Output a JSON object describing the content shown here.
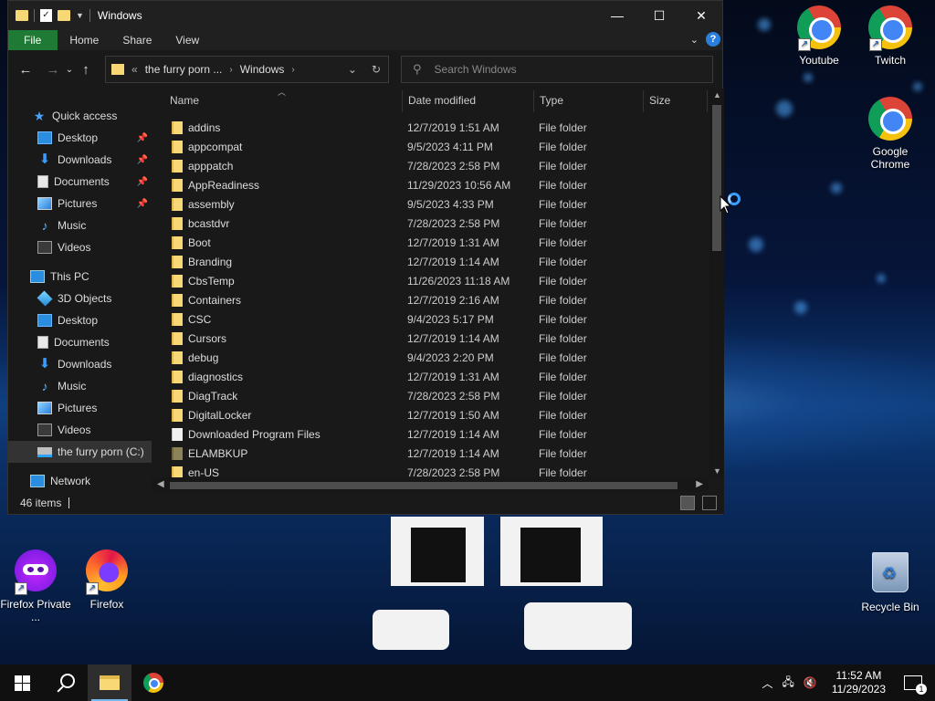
{
  "window": {
    "title": "Windows",
    "ribbon_tabs": [
      "File",
      "Home",
      "Share",
      "View"
    ],
    "address": {
      "parent": "the furry porn ...",
      "current": "Windows"
    },
    "search": {
      "placeholder": "Search Windows"
    },
    "status": {
      "item_count": "46 items"
    }
  },
  "sidebar": {
    "items": [
      {
        "label": "Quick access",
        "icon": "star-icon"
      },
      {
        "label": "Desktop",
        "icon": "desktop-icon",
        "pinned": true
      },
      {
        "label": "Downloads",
        "icon": "download-icon",
        "pinned": true
      },
      {
        "label": "Documents",
        "icon": "documents-icon",
        "pinned": true
      },
      {
        "label": "Pictures",
        "icon": "pictures-icon",
        "pinned": true
      },
      {
        "label": "Music",
        "icon": "music-icon"
      },
      {
        "label": "Videos",
        "icon": "videos-icon"
      },
      {
        "label": "This PC",
        "icon": "computer-icon"
      },
      {
        "label": "3D Objects",
        "icon": "3d-objects-icon"
      },
      {
        "label": "Desktop",
        "icon": "desktop-icon"
      },
      {
        "label": "Documents",
        "icon": "documents-icon"
      },
      {
        "label": "Downloads",
        "icon": "download-icon"
      },
      {
        "label": "Music",
        "icon": "music-icon"
      },
      {
        "label": "Pictures",
        "icon": "pictures-icon"
      },
      {
        "label": "Videos",
        "icon": "videos-icon"
      },
      {
        "label": "the furry porn (C:)",
        "icon": "drive-icon",
        "selected": true
      },
      {
        "label": "Network",
        "icon": "network-icon"
      }
    ]
  },
  "table": {
    "headers": {
      "name": "Name",
      "date": "Date modified",
      "type": "Type",
      "size": "Size"
    },
    "rows": [
      {
        "name": "addins",
        "date": "12/7/2019 1:51 AM",
        "type": "File folder"
      },
      {
        "name": "appcompat",
        "date": "9/5/2023 4:11 PM",
        "type": "File folder"
      },
      {
        "name": "apppatch",
        "date": "7/28/2023 2:58 PM",
        "type": "File folder"
      },
      {
        "name": "AppReadiness",
        "date": "11/29/2023 10:56 AM",
        "type": "File folder"
      },
      {
        "name": "assembly",
        "date": "9/5/2023 4:33 PM",
        "type": "File folder"
      },
      {
        "name": "bcastdvr",
        "date": "7/28/2023 2:58 PM",
        "type": "File folder"
      },
      {
        "name": "Boot",
        "date": "12/7/2019 1:31 AM",
        "type": "File folder"
      },
      {
        "name": "Branding",
        "date": "12/7/2019 1:14 AM",
        "type": "File folder"
      },
      {
        "name": "CbsTemp",
        "date": "11/26/2023 11:18 AM",
        "type": "File folder"
      },
      {
        "name": "Containers",
        "date": "12/7/2019 2:16 AM",
        "type": "File folder"
      },
      {
        "name": "CSC",
        "date": "9/4/2023 5:17 PM",
        "type": "File folder"
      },
      {
        "name": "Cursors",
        "date": "12/7/2019 1:14 AM",
        "type": "File folder"
      },
      {
        "name": "debug",
        "date": "9/4/2023 2:20 PM",
        "type": "File folder"
      },
      {
        "name": "diagnostics",
        "date": "12/7/2019 1:31 AM",
        "type": "File folder"
      },
      {
        "name": "DiagTrack",
        "date": "7/28/2023 2:58 PM",
        "type": "File folder"
      },
      {
        "name": "DigitalLocker",
        "date": "12/7/2019 1:50 AM",
        "type": "File folder"
      },
      {
        "name": "Downloaded Program Files",
        "date": "12/7/2019 1:14 AM",
        "type": "File folder",
        "icon": "document-icon"
      },
      {
        "name": "ELAMBKUP",
        "date": "12/7/2019 1:14 AM",
        "type": "File folder",
        "icon": "hidden-folder-icon"
      },
      {
        "name": "en-US",
        "date": "7/28/2023 2:58 PM",
        "type": "File folder"
      }
    ]
  },
  "desktop": {
    "icons": [
      {
        "label": "Youtube",
        "icon": "chrome-icon"
      },
      {
        "label": "Twitch",
        "icon": "chrome-icon"
      },
      {
        "label": "Google Chrome",
        "icon": "chrome-icon"
      },
      {
        "label": "Firefox Private ...",
        "icon": "firefox-private-icon"
      },
      {
        "label": "Firefox",
        "icon": "firefox-icon"
      },
      {
        "label": "Recycle Bin",
        "icon": "recycle-bin-icon"
      }
    ]
  },
  "taskbar": {
    "clock_time": "11:52 AM",
    "clock_date": "11/29/2023",
    "notification_count": "1"
  },
  "colors": {
    "file_tab": "#1e7a34",
    "folder": "#f8d775",
    "accent": "#2a7fde"
  }
}
